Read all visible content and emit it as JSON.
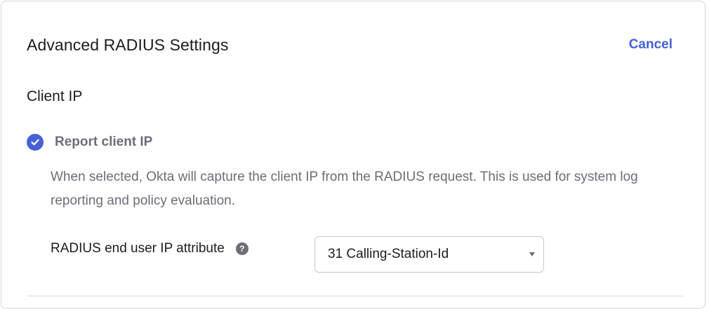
{
  "panel": {
    "title": "Advanced RADIUS Settings",
    "cancel_label": "Cancel"
  },
  "client_ip": {
    "section_title": "Client IP",
    "report_checkbox": {
      "label": "Report client IP",
      "checked": true
    },
    "help_text": "When selected, Okta will capture the client IP from the RADIUS request. This is used for system log reporting and policy evaluation.",
    "ip_attribute": {
      "label": "RADIUS end user IP attribute",
      "help_icon": "?",
      "selected_value": "31 Calling-Station-Id"
    }
  },
  "colors": {
    "accent": "#4661d6",
    "text_primary": "#1d1d21",
    "text_secondary": "#6e6e78",
    "border": "#d7d7dc"
  },
  "icons": {
    "checkbox": "check-circle-icon",
    "help": "question-mark-icon",
    "caret": "caret-down-icon"
  }
}
